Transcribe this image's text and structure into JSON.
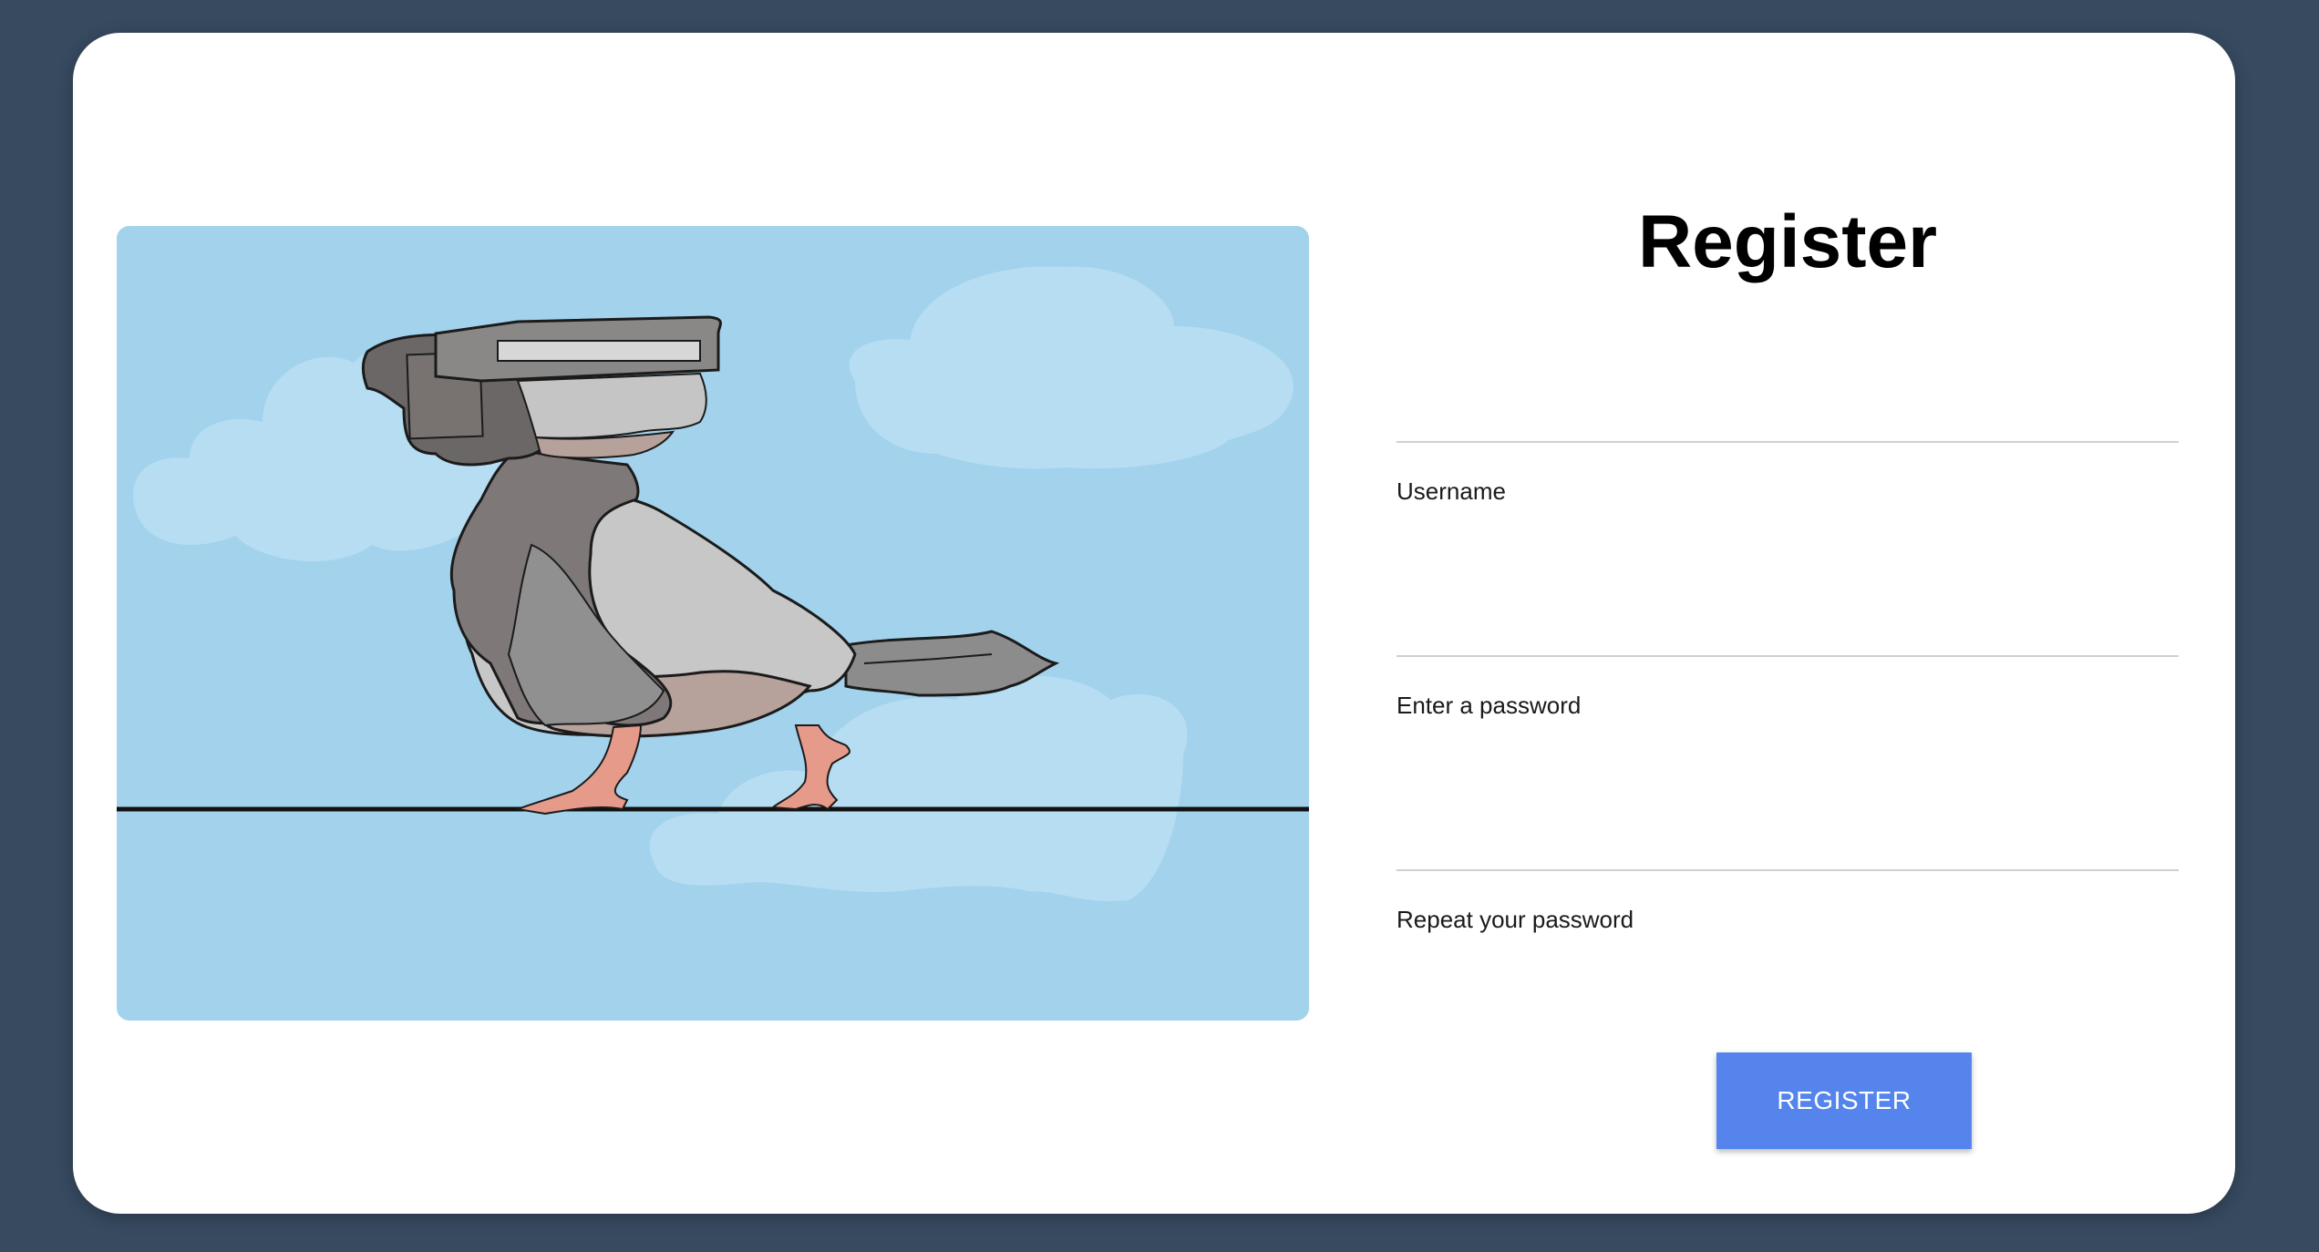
{
  "form": {
    "title": "Register",
    "fields": [
      {
        "label": "Username",
        "value": "",
        "type": "text"
      },
      {
        "label": "Enter a password",
        "value": "",
        "type": "password"
      },
      {
        "label": "Repeat your password",
        "value": "",
        "type": "password"
      }
    ],
    "submit_label": "REGISTER"
  },
  "colors": {
    "page_background": "#374a60",
    "card_background": "#ffffff",
    "sky": "#a3d2ed",
    "button": "#5585ec"
  },
  "illustration": {
    "subject": "pigeon-with-cctv-camera-head-icon"
  }
}
